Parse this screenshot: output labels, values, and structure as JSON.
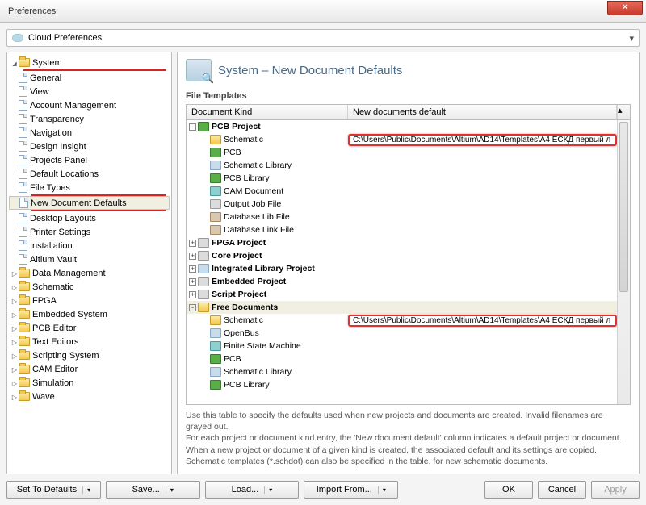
{
  "window": {
    "title": "Preferences"
  },
  "cloudbar": {
    "label": "Cloud Preferences"
  },
  "tree": {
    "system": {
      "label": "System",
      "expanded": true,
      "items": [
        "General",
        "View",
        "Account Management",
        "Transparency",
        "Navigation",
        "Design Insight",
        "Projects Panel",
        "Default Locations",
        "File Types",
        "New Document Defaults",
        "Desktop Layouts",
        "Printer Settings",
        "Installation",
        "Altium Vault"
      ],
      "selected_index": 9
    },
    "folders": [
      "Data Management",
      "Schematic",
      "FPGA",
      "Embedded System",
      "PCB Editor",
      "Text Editors",
      "Scripting System",
      "CAM Editor",
      "Simulation",
      "Wave"
    ]
  },
  "right": {
    "heading": "System – New Document Defaults",
    "section_label": "File Templates",
    "columns": {
      "c1": "Document Kind",
      "c2": "New documents default"
    },
    "path_value": "C:\\Users\\Public\\Documents\\Altium\\AD14\\Templates\\A4 ЕСКД первый л",
    "rows": [
      {
        "type": "cat",
        "exp": "-",
        "name": "PCB Project",
        "ico": "green",
        "pad": 0
      },
      {
        "type": "item",
        "name": "Schematic",
        "ico": "fold",
        "pad": 1,
        "path": true,
        "hl": true
      },
      {
        "type": "item",
        "name": "PCB",
        "ico": "green",
        "pad": 1
      },
      {
        "type": "item",
        "name": "Schematic Library",
        "ico": "blue",
        "pad": 1
      },
      {
        "type": "item",
        "name": "PCB Library",
        "ico": "green",
        "pad": 1
      },
      {
        "type": "item",
        "name": "CAM Document",
        "ico": "cyan",
        "pad": 1
      },
      {
        "type": "item",
        "name": "Output Job File",
        "ico": "grey",
        "pad": 1
      },
      {
        "type": "item",
        "name": "Database Lib File",
        "ico": "db",
        "pad": 1
      },
      {
        "type": "item",
        "name": "Database Link File",
        "ico": "db",
        "pad": 1
      },
      {
        "type": "cat",
        "exp": "+",
        "name": "FPGA Project",
        "ico": "grey",
        "pad": 0
      },
      {
        "type": "cat",
        "exp": "+",
        "name": "Core Project",
        "ico": "grey",
        "pad": 0
      },
      {
        "type": "cat",
        "exp": "+",
        "name": "Integrated Library Project",
        "ico": "blue",
        "pad": 0
      },
      {
        "type": "cat",
        "exp": "+",
        "name": "Embedded Project",
        "ico": "grey",
        "pad": 0
      },
      {
        "type": "cat",
        "exp": "+",
        "name": "Script Project",
        "ico": "grey",
        "pad": 0
      },
      {
        "type": "cat",
        "exp": "-",
        "name": "Free Documents",
        "ico": "fold",
        "pad": 0,
        "sel": true
      },
      {
        "type": "item",
        "name": "Schematic",
        "ico": "fold",
        "pad": 1,
        "path": true,
        "hl": true
      },
      {
        "type": "item",
        "name": "OpenBus",
        "ico": "blue",
        "pad": 1
      },
      {
        "type": "item",
        "name": "Finite State Machine",
        "ico": "cyan",
        "pad": 1
      },
      {
        "type": "item",
        "name": "PCB",
        "ico": "green",
        "pad": 1
      },
      {
        "type": "item",
        "name": "Schematic Library",
        "ico": "blue",
        "pad": 1
      },
      {
        "type": "item",
        "name": "PCB Library",
        "ico": "green",
        "pad": 1
      }
    ],
    "help": [
      "Use this table to specify the defaults used when new projects and documents are created. Invalid filenames are grayed out.",
      "For each project or document kind entry, the 'New document default' column indicates a default project or document.",
      "When a new project or document of a given kind is created, the associated default and its settings are copied.",
      "Schematic templates (*.schdot) can also be specified in the table, for new schematic documents."
    ]
  },
  "buttons": {
    "set_defaults": "Set To Defaults",
    "save": "Save...",
    "load": "Load...",
    "import": "Import From...",
    "ok": "OK",
    "cancel": "Cancel",
    "apply": "Apply"
  }
}
